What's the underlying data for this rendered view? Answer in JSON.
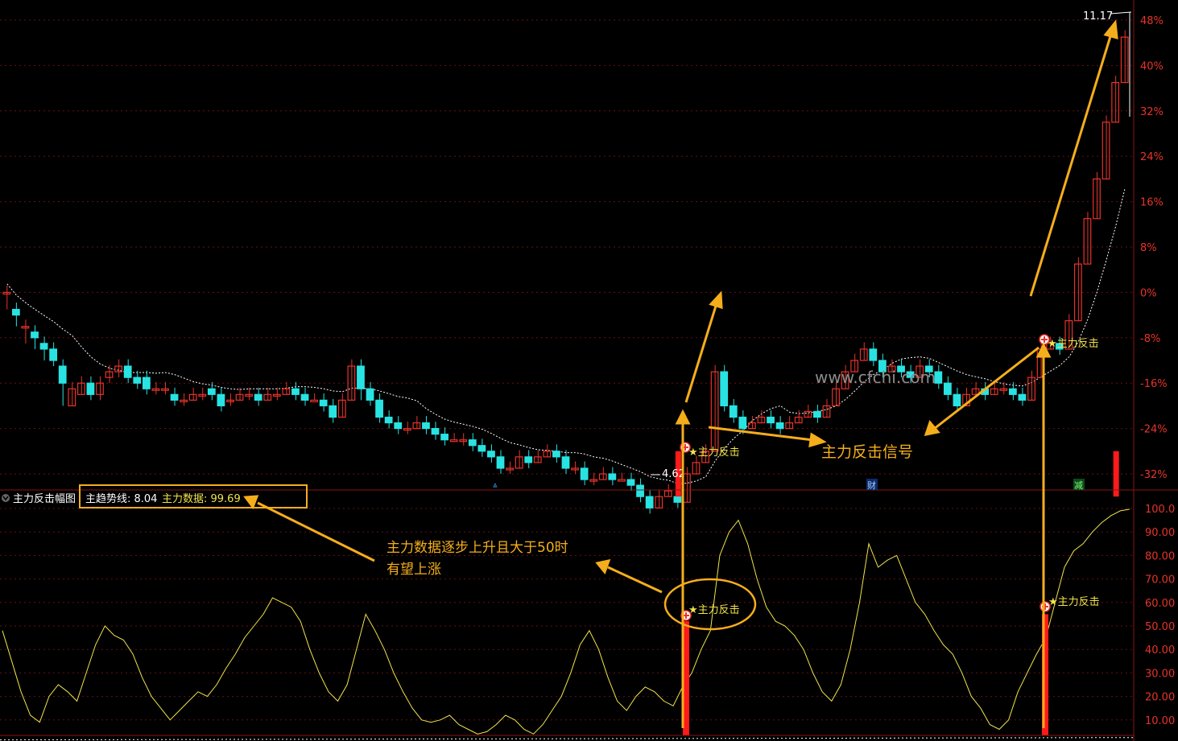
{
  "colors": {
    "up": "#e8332a",
    "down": "#29e3e3",
    "grid": "#6a0f0f",
    "yellow": "#f0e44a",
    "orange": "#f5ae1b",
    "ma": "#ffffff",
    "signal_bar": "#ff1a1a"
  },
  "upper_axis_ticks": [
    "48%",
    "40%",
    "32%",
    "24%",
    "16%",
    "8%",
    "0%",
    "-8%",
    "-16%",
    "-24%",
    "-32%"
  ],
  "lower_axis_ticks": [
    "100.0",
    "90.00",
    "80.00",
    "70.00",
    "60.00",
    "50.00",
    "40.00",
    "30.00",
    "20.00",
    "10.00"
  ],
  "price_high_label": "11.17",
  "price_low_label": "4.62",
  "indicator": {
    "name": "主力反击幅图",
    "trend_label": "主趋势线: 8.04",
    "data_label": "主力数据: 99.69"
  },
  "markers": {
    "cai": "财",
    "jian": "减"
  },
  "signals": {
    "label": "★主力反击"
  },
  "annotations": {
    "signal_text": "主力反击信号",
    "desc_line1": "主力数据逐步上升且大于50时",
    "desc_line2": "有望上涨"
  },
  "watermark": "www.cfchi.com",
  "chart_data": {
    "type": "candlestick",
    "pct_axis_range": [
      -40,
      50
    ],
    "candles": [
      [
        0,
        0,
        -3
      ],
      [
        -3,
        -4,
        -6
      ],
      [
        -6,
        -6,
        -9
      ],
      [
        -7,
        -8,
        -10
      ],
      [
        -9,
        -10,
        -12
      ],
      [
        -10,
        -12,
        -13
      ],
      [
        -13,
        -16,
        -20
      ],
      [
        -20,
        -17,
        -18
      ],
      [
        -18,
        -16,
        -17
      ],
      [
        -16,
        -18,
        -19
      ],
      [
        -18,
        -16,
        -19
      ],
      [
        -15,
        -14,
        -16
      ],
      [
        -14,
        -13,
        -15
      ],
      [
        -13,
        -15,
        -16
      ],
      [
        -15,
        -16,
        -17
      ],
      [
        -15,
        -17,
        -18
      ],
      [
        -17,
        -17,
        -18
      ],
      [
        -17,
        -17,
        -18
      ],
      [
        -18,
        -19,
        -20
      ],
      [
        -19,
        -19,
        -20
      ],
      [
        -19,
        -18,
        -19
      ],
      [
        -18,
        -18,
        -19
      ],
      [
        -17,
        -18,
        -19
      ],
      [
        -18,
        -20,
        -21
      ],
      [
        -19,
        -19,
        -20
      ],
      [
        -19,
        -18,
        -19
      ],
      [
        -18,
        -18,
        -19
      ],
      [
        -18,
        -19,
        -20
      ],
      [
        -19,
        -18,
        -19
      ],
      [
        -18,
        -18,
        -19
      ],
      [
        -18,
        -17,
        -18
      ],
      [
        -17,
        -18,
        -19
      ],
      [
        -18,
        -19,
        -20
      ],
      [
        -19,
        -19,
        -19
      ],
      [
        -19,
        -20,
        -21
      ],
      [
        -20,
        -22,
        -23
      ],
      [
        -22,
        -19,
        -20
      ],
      [
        -19,
        -13,
        -15
      ],
      [
        -13,
        -17,
        -19
      ],
      [
        -17,
        -19,
        -20
      ],
      [
        -19,
        -22,
        -23
      ],
      [
        -22,
        -23,
        -24
      ],
      [
        -23,
        -24,
        -25
      ],
      [
        -24,
        -24,
        -25
      ],
      [
        -24,
        -23,
        -24
      ],
      [
        -23,
        -24,
        -25
      ],
      [
        -24,
        -25,
        -26
      ],
      [
        -25,
        -26,
        -27
      ],
      [
        -26,
        -26,
        -26
      ],
      [
        -26,
        -26,
        -27
      ],
      [
        -26,
        -27,
        -28
      ],
      [
        -27,
        -28,
        -29
      ],
      [
        -28,
        -29,
        -30
      ],
      [
        -29,
        -31,
        -32
      ],
      [
        -31,
        -31,
        -32
      ],
      [
        -31,
        -29,
        -30
      ],
      [
        -29,
        -30,
        -31
      ],
      [
        -30,
        -29,
        -30
      ],
      [
        -29,
        -28,
        -29
      ],
      [
        -28,
        -29,
        -30
      ],
      [
        -29,
        -31,
        -32
      ],
      [
        -31,
        -31,
        -32
      ],
      [
        -31,
        -33,
        -34
      ],
      [
        -33,
        -33,
        -34
      ],
      [
        -33,
        -32,
        -33
      ],
      [
        -32,
        -33,
        -34
      ],
      [
        -33,
        -33,
        -33
      ],
      [
        -33,
        -34,
        -35
      ],
      [
        -34,
        -36,
        -37
      ],
      [
        -36,
        -38,
        -39
      ],
      [
        -38,
        -36,
        -37
      ],
      [
        -36,
        -35,
        -36
      ],
      [
        -36,
        -37,
        -38
      ],
      [
        -37,
        -32,
        -33
      ],
      [
        -32,
        -30,
        -31
      ],
      [
        -30,
        -28,
        -29
      ],
      [
        -28,
        -14,
        -15
      ],
      [
        -14,
        -20,
        -21
      ],
      [
        -20,
        -22,
        -23
      ],
      [
        -22,
        -24,
        -25
      ],
      [
        -24,
        -23,
        -24
      ],
      [
        -23,
        -22,
        -23
      ],
      [
        -22,
        -23,
        -24
      ],
      [
        -23,
        -24,
        -25
      ],
      [
        -24,
        -23,
        -24
      ],
      [
        -23,
        -22,
        -23
      ],
      [
        -22,
        -21,
        -22
      ],
      [
        -21,
        -22,
        -23
      ],
      [
        -22,
        -20,
        -21
      ],
      [
        -20,
        -17,
        -18
      ],
      [
        -17,
        -14,
        -15
      ],
      [
        -14,
        -12,
        -13
      ],
      [
        -12,
        -10,
        -11
      ],
      [
        -10,
        -12,
        -13
      ],
      [
        -12,
        -14,
        -15
      ],
      [
        -14,
        -13,
        -14
      ],
      [
        -13,
        -14,
        -15
      ],
      [
        -14,
        -15,
        -16
      ],
      [
        -15,
        -13,
        -14
      ],
      [
        -13,
        -14,
        -15
      ],
      [
        -14,
        -16,
        -17
      ],
      [
        -16,
        -18,
        -19
      ],
      [
        -18,
        -20,
        -21
      ],
      [
        -20,
        -18,
        -19
      ],
      [
        -18,
        -17,
        -18
      ],
      [
        -17,
        -18,
        -19
      ],
      [
        -18,
        -17,
        -18
      ],
      [
        -17,
        -17,
        -18
      ],
      [
        -17,
        -18,
        -19
      ],
      [
        -18,
        -19,
        -20
      ],
      [
        -19,
        -15,
        -16
      ],
      [
        -15,
        -10,
        -11
      ],
      [
        -10,
        -9,
        -10
      ],
      [
        -9,
        -10,
        -11
      ],
      [
        -10,
        -5,
        -6
      ],
      [
        -5,
        5,
        4
      ],
      [
        5,
        13,
        12
      ],
      [
        13,
        20,
        19
      ],
      [
        20,
        30,
        29
      ],
      [
        30,
        37,
        36
      ],
      [
        37,
        45,
        44
      ]
    ],
    "indicator_series": [
      48,
      35,
      22,
      12,
      9,
      20,
      25,
      22,
      18,
      30,
      42,
      50,
      46,
      44,
      38,
      28,
      20,
      15,
      10,
      14,
      18,
      22,
      20,
      25,
      32,
      38,
      45,
      50,
      55,
      62,
      60,
      58,
      52,
      40,
      30,
      22,
      18,
      25,
      40,
      55,
      48,
      40,
      30,
      22,
      15,
      10,
      9,
      10,
      12,
      8,
      6,
      4,
      5,
      8,
      12,
      10,
      6,
      4,
      8,
      14,
      20,
      30,
      42,
      48,
      40,
      28,
      18,
      14,
      20,
      24,
      22,
      18,
      16,
      24,
      30,
      40,
      48,
      80,
      90,
      95,
      85,
      70,
      58,
      52,
      50,
      46,
      40,
      30,
      22,
      18,
      25,
      40,
      60,
      85,
      75,
      78,
      80,
      70,
      60,
      55,
      48,
      42,
      38,
      30,
      20,
      15,
      8,
      6,
      10,
      22,
      30,
      38,
      45,
      60,
      75,
      82,
      85,
      90,
      94,
      97,
      99,
      99.69
    ],
    "signal_indices": [
      72,
      119
    ]
  }
}
